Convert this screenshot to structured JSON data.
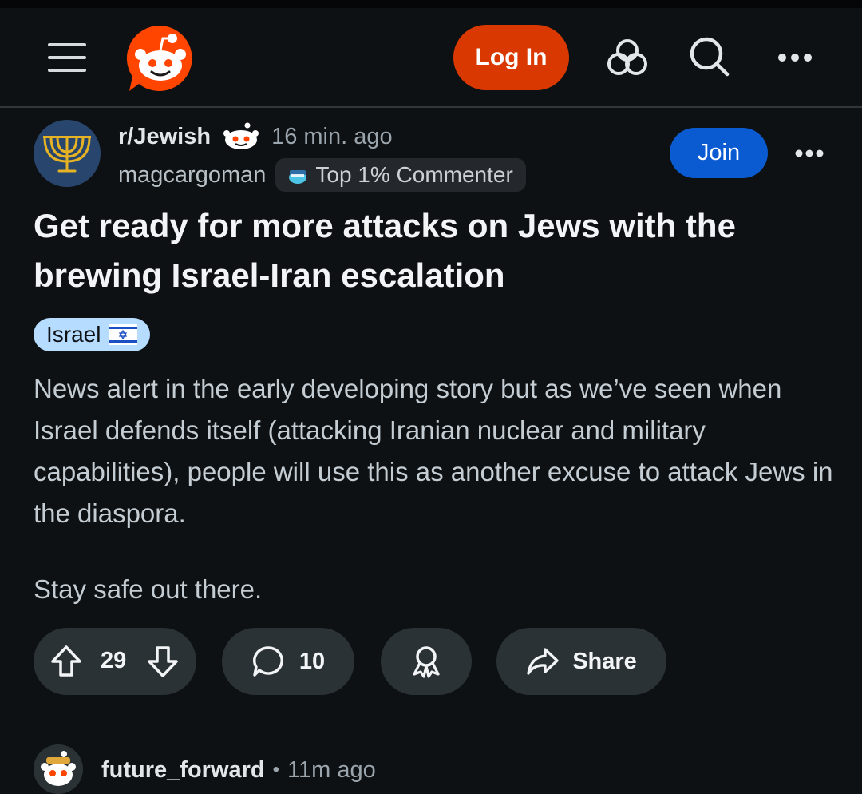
{
  "header": {
    "login_label": "Log In",
    "icons": [
      "menu-icon",
      "reddit-logo",
      "trending-icon",
      "search-icon",
      "more-icon"
    ],
    "accent_color": "#d93900"
  },
  "post": {
    "subreddit": "r/Jewish",
    "time": "16 min. ago",
    "author": "magcargoman",
    "badge": "Top 1% Commenter",
    "join_label": "Join",
    "title": "Get ready for more attacks on Jews with the brewing Israel-Iran escalation",
    "flair": "Israel",
    "flair_color": "#b6dcff",
    "body": [
      "News alert in the early developing story but as we’ve seen when Israel defends itself (attacking Iranian nuclear and military capabilities), people will use this as another excuse to attack Jews in the diaspora.",
      "Stay safe out there."
    ],
    "votes": "29",
    "comments": "10",
    "share_label": "Share"
  },
  "comment": {
    "author": "future_forward",
    "separator": "•",
    "time": "11m ago"
  }
}
